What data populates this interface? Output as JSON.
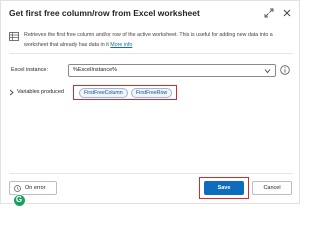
{
  "dialog": {
    "title": "Get first free column/row from Excel worksheet"
  },
  "info": {
    "text": "Retrieves the first free column and/or row of the active worksheet. This is useful for adding new data into a worksheet that already has data in it",
    "link": "More info"
  },
  "form": {
    "excel_instance_label": "Excel instance:",
    "excel_instance_value": "%ExcelInstance%"
  },
  "variables": {
    "label": "Variables produced",
    "items": [
      "FirstFreeColumn",
      "FirstFreeRow"
    ]
  },
  "footer": {
    "on_error": "On error",
    "save": "Save",
    "cancel": "Cancel"
  },
  "brand": {
    "logo_letter": "G"
  },
  "colors": {
    "accent": "#0f6cbd",
    "highlight": "#d42a2a",
    "brand": "#18a05e"
  }
}
